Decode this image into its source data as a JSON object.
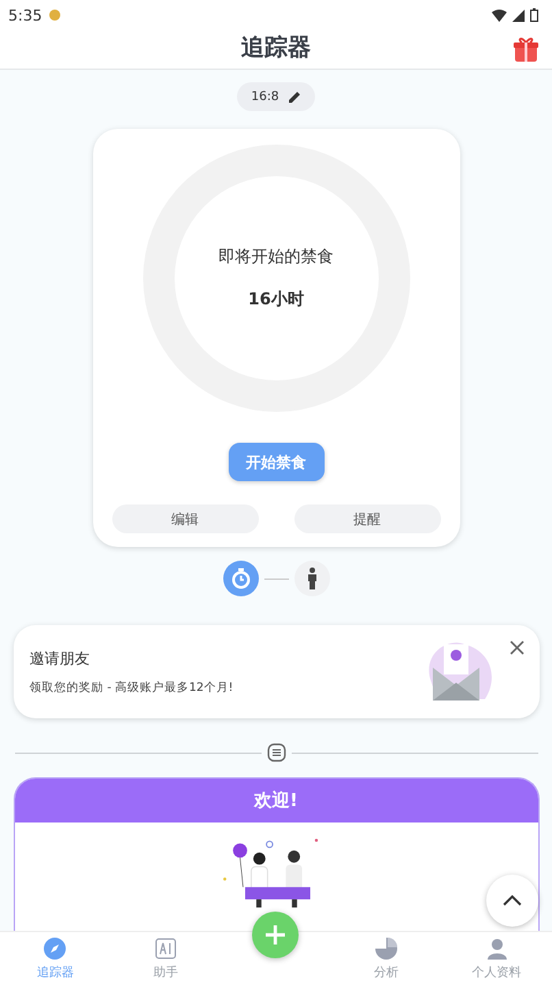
{
  "status_bar": {
    "time": "5:35"
  },
  "header": {
    "title": "追踪器"
  },
  "plan": {
    "label": "16:8"
  },
  "timer": {
    "status": "即将开始的禁食",
    "duration": "16小时",
    "level": 0,
    "start_button": "开始禁食",
    "actions": [
      "编辑",
      "提醒"
    ]
  },
  "steps": [
    {
      "kind": "timer",
      "selected": true
    },
    {
      "kind": "body",
      "selected": false
    }
  ],
  "invite": {
    "title": "邀请朋友",
    "text": "领取您的奖励 - 高级账户最多12个月!"
  },
  "welcome": {
    "title": "欢迎!"
  },
  "nav": [
    {
      "label": "追踪器",
      "kind": "tracker",
      "selected": true
    },
    {
      "label": "助手",
      "kind": "ai",
      "selected": false
    },
    {
      "label": "分析",
      "kind": "chart",
      "selected": false
    },
    {
      "label": "个人资料",
      "kind": "profile",
      "selected": false
    }
  ]
}
